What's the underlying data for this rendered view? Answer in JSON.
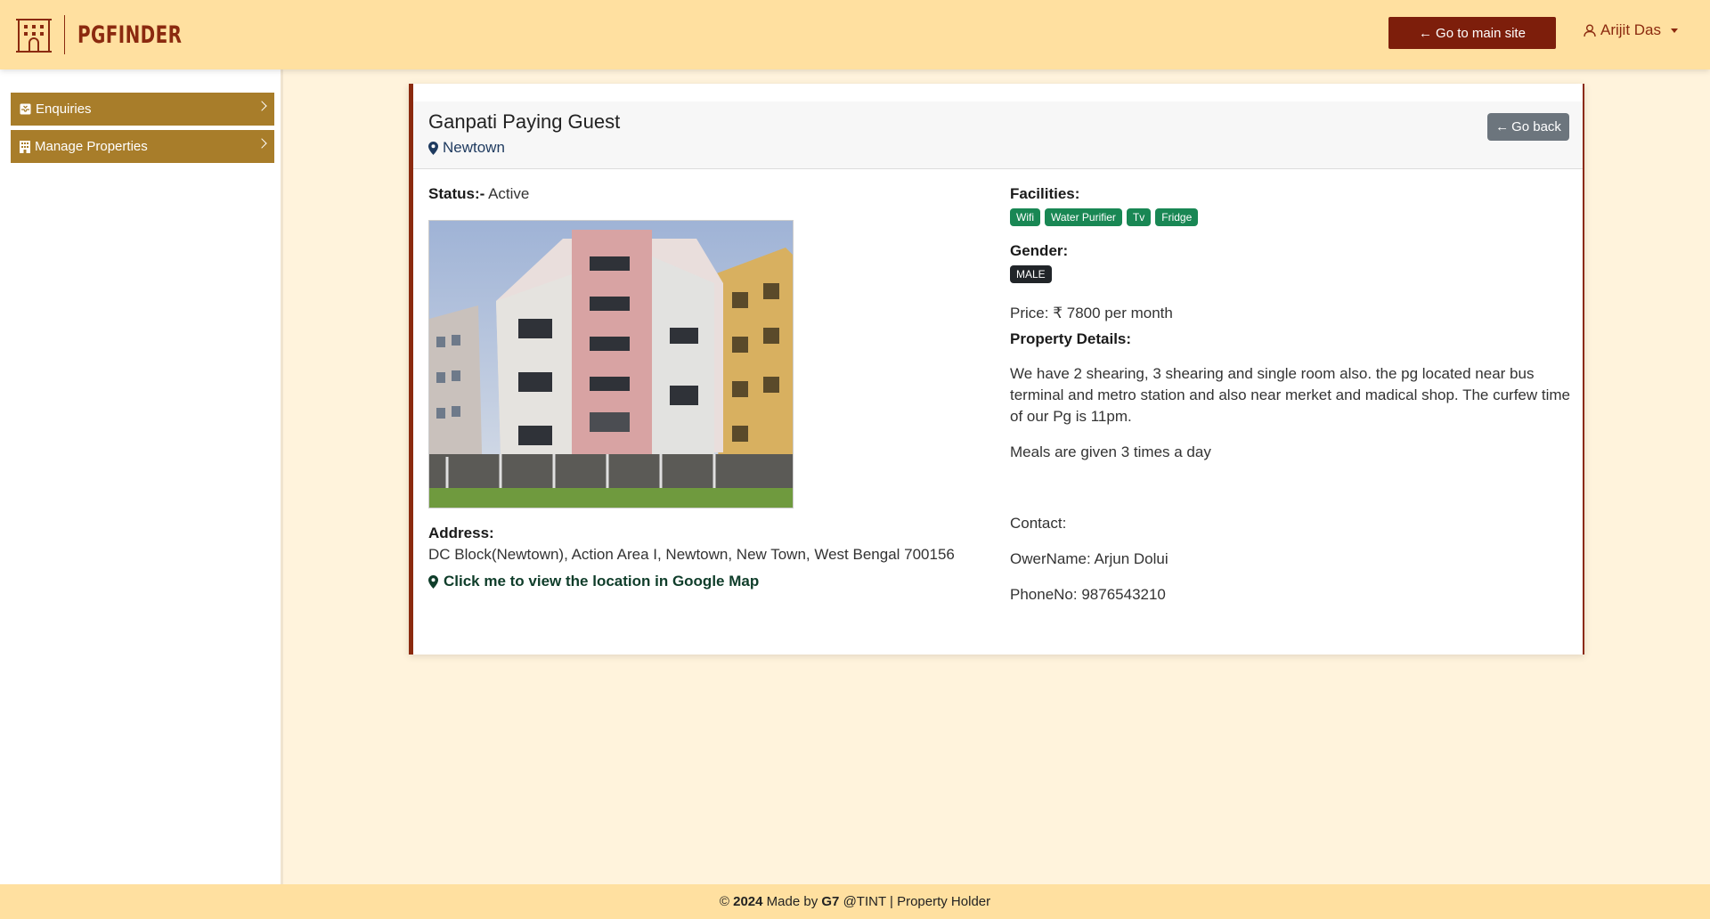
{
  "brand": {
    "name": "PGFINDER"
  },
  "header": {
    "main_site_label": "Go to main site",
    "user_name": "Arijit Das"
  },
  "sidebar": {
    "items": [
      {
        "label": "Enquiries",
        "icon": "inbox-icon"
      },
      {
        "label": "Manage Properties",
        "icon": "building-icon"
      }
    ]
  },
  "property": {
    "name": "Ganpati Paying Guest",
    "location": "Newtown",
    "go_back_label": "Go back",
    "status_label": "Status:-",
    "status_value": "Active",
    "address_label": "Address:",
    "address_value": "DC Block(Newtown), Action Area I, Newtown, New Town, West Bengal 700156",
    "map_link_label": "Click me to view the location in Google Map",
    "facilities_label": "Facilities:",
    "facilities": [
      "Wifi",
      "Water Purifier",
      "Tv",
      "Fridge"
    ],
    "gender_label": "Gender:",
    "gender_value": "MALE",
    "price_label": "Price:",
    "price_value": "7800 per month",
    "details_label": "Property Details:",
    "details_text": "We have 2 shearing, 3 shearing and single room also. the pg located near bus terminal and metro station and also near merket and madical shop. The curfew time of our Pg is 11pm.",
    "meals_text": "Meals are given 3 times a day",
    "contact_label": "Contact:",
    "owner_line": "OwerName: Arjun Dolui",
    "phone_line": "PhoneNo: 9876543210"
  },
  "footer": {
    "year": "2024",
    "made_by_prefix": "Made by",
    "team": "G7",
    "suffix": "@TINT | Property Holder"
  },
  "colors": {
    "header_bg": "#ffe0a0",
    "accent_dark_red": "#7d1e0b",
    "sidebar_item_bg": "#a87d2a",
    "badge_green": "#198754",
    "badge_dark": "#212529",
    "page_bg": "#fff3dc"
  }
}
